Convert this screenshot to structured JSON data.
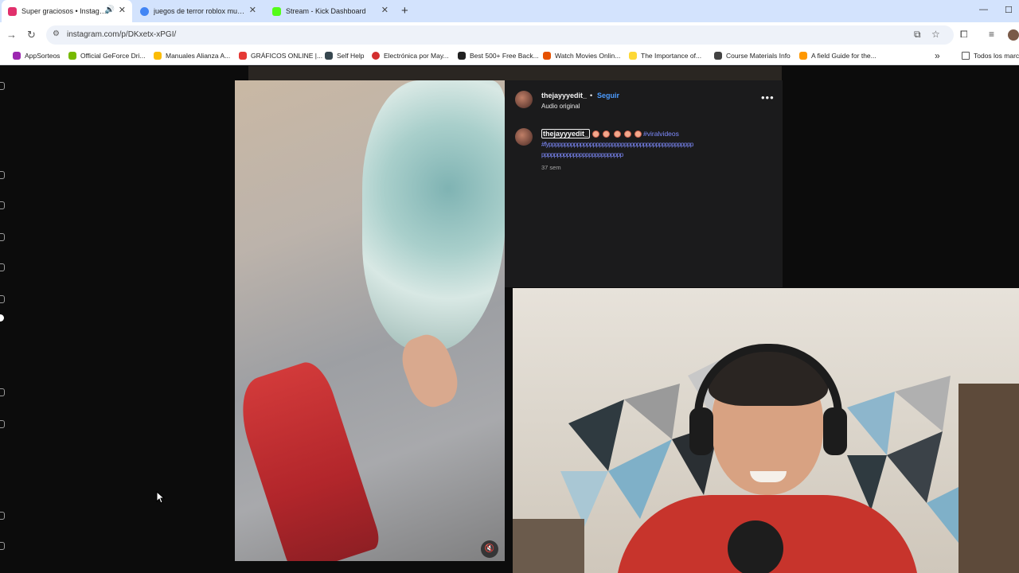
{
  "browser": {
    "tabs": [
      {
        "label": "Super graciosos • Instagram",
        "favicon_color": "#e1306c",
        "active": true,
        "audio": true
      },
      {
        "label": "juegos de terror roblox multijug",
        "favicon_color": "#4285f4",
        "active": false
      },
      {
        "label": "Stream - Kick Dashboard",
        "favicon_color": "#53fc18",
        "active": false
      }
    ],
    "new_tab_glyph": "+",
    "url": "instagram.com/p/DKxetx-xPGI/",
    "bookmarks": [
      {
        "label": "AppSorteos",
        "color": "#9c27b0"
      },
      {
        "label": "Official GeForce Dri...",
        "color": "#76b900"
      },
      {
        "label": "Manuales Alianza A...",
        "color": "#fbbc04"
      },
      {
        "label": "GRÁFICOS ONLINE |...",
        "color": "#e53935"
      },
      {
        "label": "Self Help",
        "color": "#37474f"
      },
      {
        "label": "Electrónica por May...",
        "color": "#d32f2f"
      },
      {
        "label": "Best 500+ Free Back...",
        "color": "#212121"
      },
      {
        "label": "Watch Movies Onlin...",
        "color": "#e65100"
      },
      {
        "label": "The Importance of...",
        "color": "#fdd835"
      },
      {
        "label": "Course Materials Info",
        "color": "#424242"
      },
      {
        "label": "A field Guide for the...",
        "color": "#ff9800"
      }
    ],
    "other_bookmarks": "Todos los marc"
  },
  "post": {
    "username": "thejayyyedit_",
    "separator": "•",
    "follow_label": "Seguir",
    "audio_label": "Audio original",
    "more_glyph": "•••",
    "caption_user": "thejayyyedit_",
    "hashtag": "#viralvideos",
    "hashtag_line1": "#fypppppppppppppppppppppppppppppppppppppppppppppp",
    "hashtag_line2": "pppppppppppppppppppppppppp",
    "time": "37 sem",
    "muted_glyph": "🔇"
  }
}
